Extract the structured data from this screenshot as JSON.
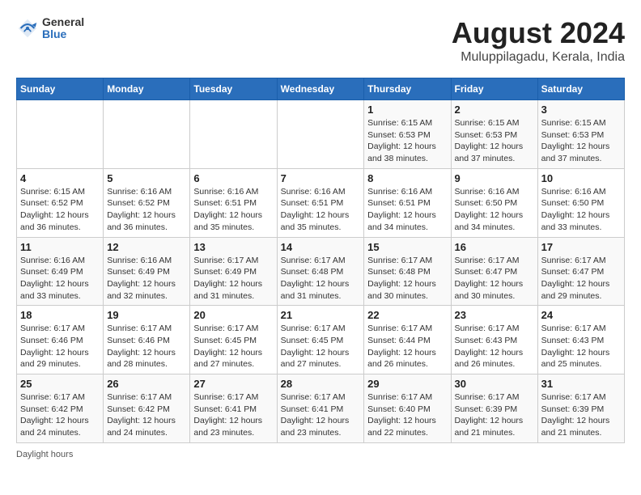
{
  "header": {
    "logo_general": "General",
    "logo_blue": "Blue",
    "title": "August 2024",
    "subtitle": "Muluppilagadu, Kerala, India"
  },
  "days_of_week": [
    "Sunday",
    "Monday",
    "Tuesday",
    "Wednesday",
    "Thursday",
    "Friday",
    "Saturday"
  ],
  "weeks": [
    [
      {
        "day": "",
        "detail": ""
      },
      {
        "day": "",
        "detail": ""
      },
      {
        "day": "",
        "detail": ""
      },
      {
        "day": "",
        "detail": ""
      },
      {
        "day": "1",
        "detail": "Sunrise: 6:15 AM\nSunset: 6:53 PM\nDaylight: 12 hours\nand 38 minutes."
      },
      {
        "day": "2",
        "detail": "Sunrise: 6:15 AM\nSunset: 6:53 PM\nDaylight: 12 hours\nand 37 minutes."
      },
      {
        "day": "3",
        "detail": "Sunrise: 6:15 AM\nSunset: 6:53 PM\nDaylight: 12 hours\nand 37 minutes."
      }
    ],
    [
      {
        "day": "4",
        "detail": "Sunrise: 6:15 AM\nSunset: 6:52 PM\nDaylight: 12 hours\nand 36 minutes."
      },
      {
        "day": "5",
        "detail": "Sunrise: 6:16 AM\nSunset: 6:52 PM\nDaylight: 12 hours\nand 36 minutes."
      },
      {
        "day": "6",
        "detail": "Sunrise: 6:16 AM\nSunset: 6:51 PM\nDaylight: 12 hours\nand 35 minutes."
      },
      {
        "day": "7",
        "detail": "Sunrise: 6:16 AM\nSunset: 6:51 PM\nDaylight: 12 hours\nand 35 minutes."
      },
      {
        "day": "8",
        "detail": "Sunrise: 6:16 AM\nSunset: 6:51 PM\nDaylight: 12 hours\nand 34 minutes."
      },
      {
        "day": "9",
        "detail": "Sunrise: 6:16 AM\nSunset: 6:50 PM\nDaylight: 12 hours\nand 34 minutes."
      },
      {
        "day": "10",
        "detail": "Sunrise: 6:16 AM\nSunset: 6:50 PM\nDaylight: 12 hours\nand 33 minutes."
      }
    ],
    [
      {
        "day": "11",
        "detail": "Sunrise: 6:16 AM\nSunset: 6:49 PM\nDaylight: 12 hours\nand 33 minutes."
      },
      {
        "day": "12",
        "detail": "Sunrise: 6:16 AM\nSunset: 6:49 PM\nDaylight: 12 hours\nand 32 minutes."
      },
      {
        "day": "13",
        "detail": "Sunrise: 6:17 AM\nSunset: 6:49 PM\nDaylight: 12 hours\nand 31 minutes."
      },
      {
        "day": "14",
        "detail": "Sunrise: 6:17 AM\nSunset: 6:48 PM\nDaylight: 12 hours\nand 31 minutes."
      },
      {
        "day": "15",
        "detail": "Sunrise: 6:17 AM\nSunset: 6:48 PM\nDaylight: 12 hours\nand 30 minutes."
      },
      {
        "day": "16",
        "detail": "Sunrise: 6:17 AM\nSunset: 6:47 PM\nDaylight: 12 hours\nand 30 minutes."
      },
      {
        "day": "17",
        "detail": "Sunrise: 6:17 AM\nSunset: 6:47 PM\nDaylight: 12 hours\nand 29 minutes."
      }
    ],
    [
      {
        "day": "18",
        "detail": "Sunrise: 6:17 AM\nSunset: 6:46 PM\nDaylight: 12 hours\nand 29 minutes."
      },
      {
        "day": "19",
        "detail": "Sunrise: 6:17 AM\nSunset: 6:46 PM\nDaylight: 12 hours\nand 28 minutes."
      },
      {
        "day": "20",
        "detail": "Sunrise: 6:17 AM\nSunset: 6:45 PM\nDaylight: 12 hours\nand 27 minutes."
      },
      {
        "day": "21",
        "detail": "Sunrise: 6:17 AM\nSunset: 6:45 PM\nDaylight: 12 hours\nand 27 minutes."
      },
      {
        "day": "22",
        "detail": "Sunrise: 6:17 AM\nSunset: 6:44 PM\nDaylight: 12 hours\nand 26 minutes."
      },
      {
        "day": "23",
        "detail": "Sunrise: 6:17 AM\nSunset: 6:43 PM\nDaylight: 12 hours\nand 26 minutes."
      },
      {
        "day": "24",
        "detail": "Sunrise: 6:17 AM\nSunset: 6:43 PM\nDaylight: 12 hours\nand 25 minutes."
      }
    ],
    [
      {
        "day": "25",
        "detail": "Sunrise: 6:17 AM\nSunset: 6:42 PM\nDaylight: 12 hours\nand 24 minutes."
      },
      {
        "day": "26",
        "detail": "Sunrise: 6:17 AM\nSunset: 6:42 PM\nDaylight: 12 hours\nand 24 minutes."
      },
      {
        "day": "27",
        "detail": "Sunrise: 6:17 AM\nSunset: 6:41 PM\nDaylight: 12 hours\nand 23 minutes."
      },
      {
        "day": "28",
        "detail": "Sunrise: 6:17 AM\nSunset: 6:41 PM\nDaylight: 12 hours\nand 23 minutes."
      },
      {
        "day": "29",
        "detail": "Sunrise: 6:17 AM\nSunset: 6:40 PM\nDaylight: 12 hours\nand 22 minutes."
      },
      {
        "day": "30",
        "detail": "Sunrise: 6:17 AM\nSunset: 6:39 PM\nDaylight: 12 hours\nand 21 minutes."
      },
      {
        "day": "31",
        "detail": "Sunrise: 6:17 AM\nSunset: 6:39 PM\nDaylight: 12 hours\nand 21 minutes."
      }
    ]
  ],
  "footer": "Daylight hours"
}
